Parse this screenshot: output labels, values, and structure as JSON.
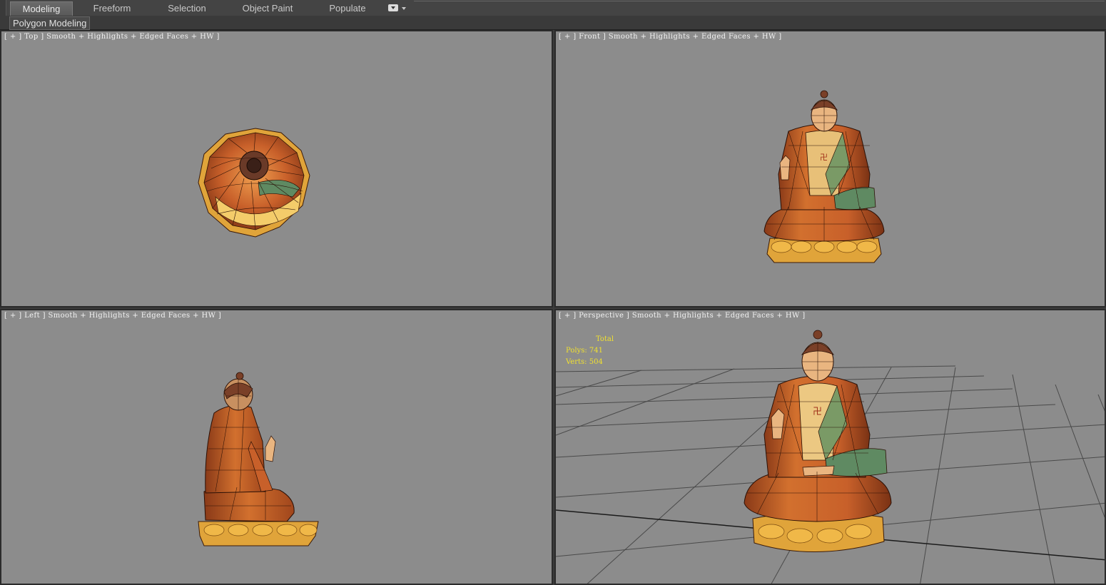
{
  "ribbon": {
    "tabs": [
      "Modeling",
      "Freeform",
      "Selection",
      "Object Paint",
      "Populate"
    ],
    "active_tab": "Modeling",
    "panel_label": "Polygon Modeling"
  },
  "viewports": {
    "top": {
      "label": "[ + ] Top ] Smooth + Highlights + Edged Faces + HW ]"
    },
    "front": {
      "label": "[ + ] Front ] Smooth + Highlights + Edged Faces + HW ]"
    },
    "left": {
      "label": "[ + ] Left ] Smooth + Highlights + Edged Faces + HW ]"
    },
    "perspective": {
      "label": "[ + ] Perspective ] Smooth + Highlights + Edged Faces + HW ]",
      "stats": {
        "header": "Total",
        "polys_label": "Polys:",
        "polys_value": "741",
        "verts_label": "Verts:",
        "verts_value": "504"
      }
    }
  },
  "colors": {
    "viewport_bg": "#8c8c8c",
    "robe": "#c8602a",
    "robe_dark": "#8a3a18",
    "skin": "#d9a06a",
    "chest": "#e8c078",
    "sash_green": "#5f8a62",
    "base_gold": "#e0a43a",
    "stats_text": "#f0e030"
  }
}
